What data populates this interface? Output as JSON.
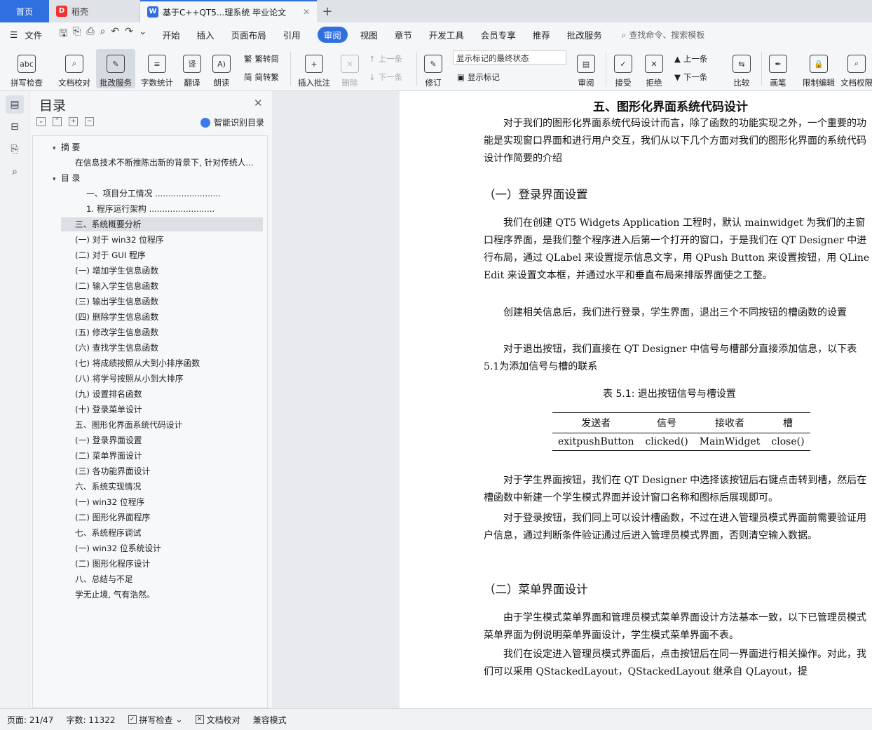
{
  "tabs": [
    {
      "label": "首页"
    },
    {
      "label": "稻壳"
    },
    {
      "label": "基于C++QT5...理系统 毕业论文"
    }
  ],
  "menu": [
    "文件",
    "开始",
    "插入",
    "页面布局",
    "引用",
    "审阅",
    "视图",
    "章节",
    "开发工具",
    "会员专享",
    "推荐",
    "批改服务"
  ],
  "menu_search": "查找命令、搜索模板",
  "ribbon": {
    "spell": "拼写检查",
    "proof": "文档校对",
    "grading": "批改服务",
    "wordcount": "字数统计",
    "translate": "翻译",
    "read": "朗读",
    "trad2simp": "繁转简",
    "simp2trad": "简转繁",
    "insert_comment": "插入批注",
    "delete": "删除",
    "prev": "上一条",
    "next": "下一条",
    "revise": "修订",
    "markup_select": "显示标记的最终状态",
    "show_markup": "显示标记",
    "review": "审阅",
    "accept": "接受",
    "reject": "拒绝",
    "prev2": "上一条",
    "next2": "下一条",
    "compare": "比较",
    "ink": "画笔",
    "restrict": "限制编辑",
    "doc_perm": "文档权限"
  },
  "toc": {
    "title": "目录",
    "smart": "智能识别目录",
    "items": [
      {
        "text": "摘  要",
        "level": 0,
        "caret": "▾"
      },
      {
        "text": "在信息技术不断推陈出新的背景下, 针对传统人...",
        "level": 1
      },
      {
        "text": "目  录",
        "level": 0,
        "caret": "▾"
      },
      {
        "text": "一、项目分工情况 .........................",
        "level": 2
      },
      {
        "text": "1. 程序运行架构 .........................",
        "level": 2
      },
      {
        "text": "三、系统概要分析",
        "level": 1,
        "selected": true
      },
      {
        "text": "(一) 对于 win32 位程序",
        "level": 1
      },
      {
        "text": "(二) 对于 GUI 程序",
        "level": 1
      },
      {
        "text": "(一) 增加学生信息函数",
        "level": 1
      },
      {
        "text": "(二) 输入学生信息函数",
        "level": 1
      },
      {
        "text": "(三) 输出学生信息函数",
        "level": 1
      },
      {
        "text": "(四) 删除学生信息函数",
        "level": 1
      },
      {
        "text": "(五) 修改学生信息函数",
        "level": 1
      },
      {
        "text": "(六) 查找学生信息函数",
        "level": 1
      },
      {
        "text": "(七) 将成绩按照从大到小排序函数",
        "level": 1
      },
      {
        "text": "(八) 将学号按照从小到大排序",
        "level": 1
      },
      {
        "text": "(九) 设置排名函数",
        "level": 1
      },
      {
        "text": "(十) 登录菜单设计",
        "level": 1
      },
      {
        "text": "五、图形化界面系统代码设计",
        "level": 0.5
      },
      {
        "text": "(一) 登录界面设置",
        "level": 1
      },
      {
        "text": "(二) 菜单界面设计",
        "level": 1
      },
      {
        "text": "(三) 各功能界面设计",
        "level": 1
      },
      {
        "text": "六、系统实现情况",
        "level": 0.5
      },
      {
        "text": "(一) win32 位程序",
        "level": 1
      },
      {
        "text": "(二) 图形化界面程序",
        "level": 1
      },
      {
        "text": "七、系统程序调试",
        "level": 0.5
      },
      {
        "text": "(一) win32 位系统设计",
        "level": 1
      },
      {
        "text": "(二) 图形化程序设计",
        "level": 1
      },
      {
        "text": "八、总结与不足",
        "level": 0.5
      },
      {
        "text": "学无止境, 气有浩然。",
        "level": 0.5
      }
    ]
  },
  "doc": {
    "h1": "五、图形化界面系统代码设计",
    "p1": "对于我们的图形化界面系统代码设计而言，除了函数的功能实现之外，一个重要的功能是实现窗口界面和进行用户交互，我们从以下几个方面对我们的图形化界面的系统代码设计作简要的介绍",
    "h2a": "（一）登录界面设置",
    "p2": "我们在创建 QT5 Widgets Application 工程时，默认 mainwidget 为我们的主窗口程序界面，是我们整个程序进入后第一个打开的窗口，于是我们在 QT Designer 中进行布局，通过 QLabel 来设置提示信息文字，用 QPush Button 来设置按钮，用 QLine Edit 来设置文本框，并通过水平和垂直布局来排版界面使之工整。",
    "p3": "创建相关信息后，我们进行登录，学生界面，退出三个不同按钮的槽函数的设置",
    "p4": "对于退出按钮，我们直接在 QT Designer 中信号与槽部分直接添加信息，以下表5.1为添加信号与槽的联系",
    "caption": "表 5.1: 退出按钮信号与槽设置",
    "table_head": [
      "发送者",
      "信号",
      "接收者",
      "槽"
    ],
    "table_row": [
      "exitpushButton",
      "clicked()",
      "MainWidget",
      "close()"
    ],
    "p5": "对于学生界面按钮，我们在 QT Designer 中选择该按钮后右键点击转到槽，然后在槽函数中新建一个学生模式界面并设计窗口名称和图标后展现即可。",
    "p6": "对于登录按钮，我们同上可以设计槽函数，不过在进入管理员模式界面前需要验证用户信息，通过判断条件验证通过后进入管理员模式界面，否则清空输入数据。",
    "h2b": "（二）菜单界面设计",
    "p7": "由于学生模式菜单界面和管理员模式菜单界面设计方法基本一致，以下已管理员模式菜单界面为例说明菜单界面设计，学生模式菜单界面不表。",
    "p8": "我们在设定进入管理员模式界面后，点击按钮后在同一界面进行相关操作。对此，我们可以采用 QStackedLayout，QStackedLayout 继承自 QLayout，提"
  },
  "status": {
    "page": "页面: 21/47",
    "words": "字数: 11322",
    "spell": "拼写检查",
    "proof": "文档校对",
    "compat": "兼容模式"
  },
  "colors": {
    "accent": "#2f6fe0"
  }
}
